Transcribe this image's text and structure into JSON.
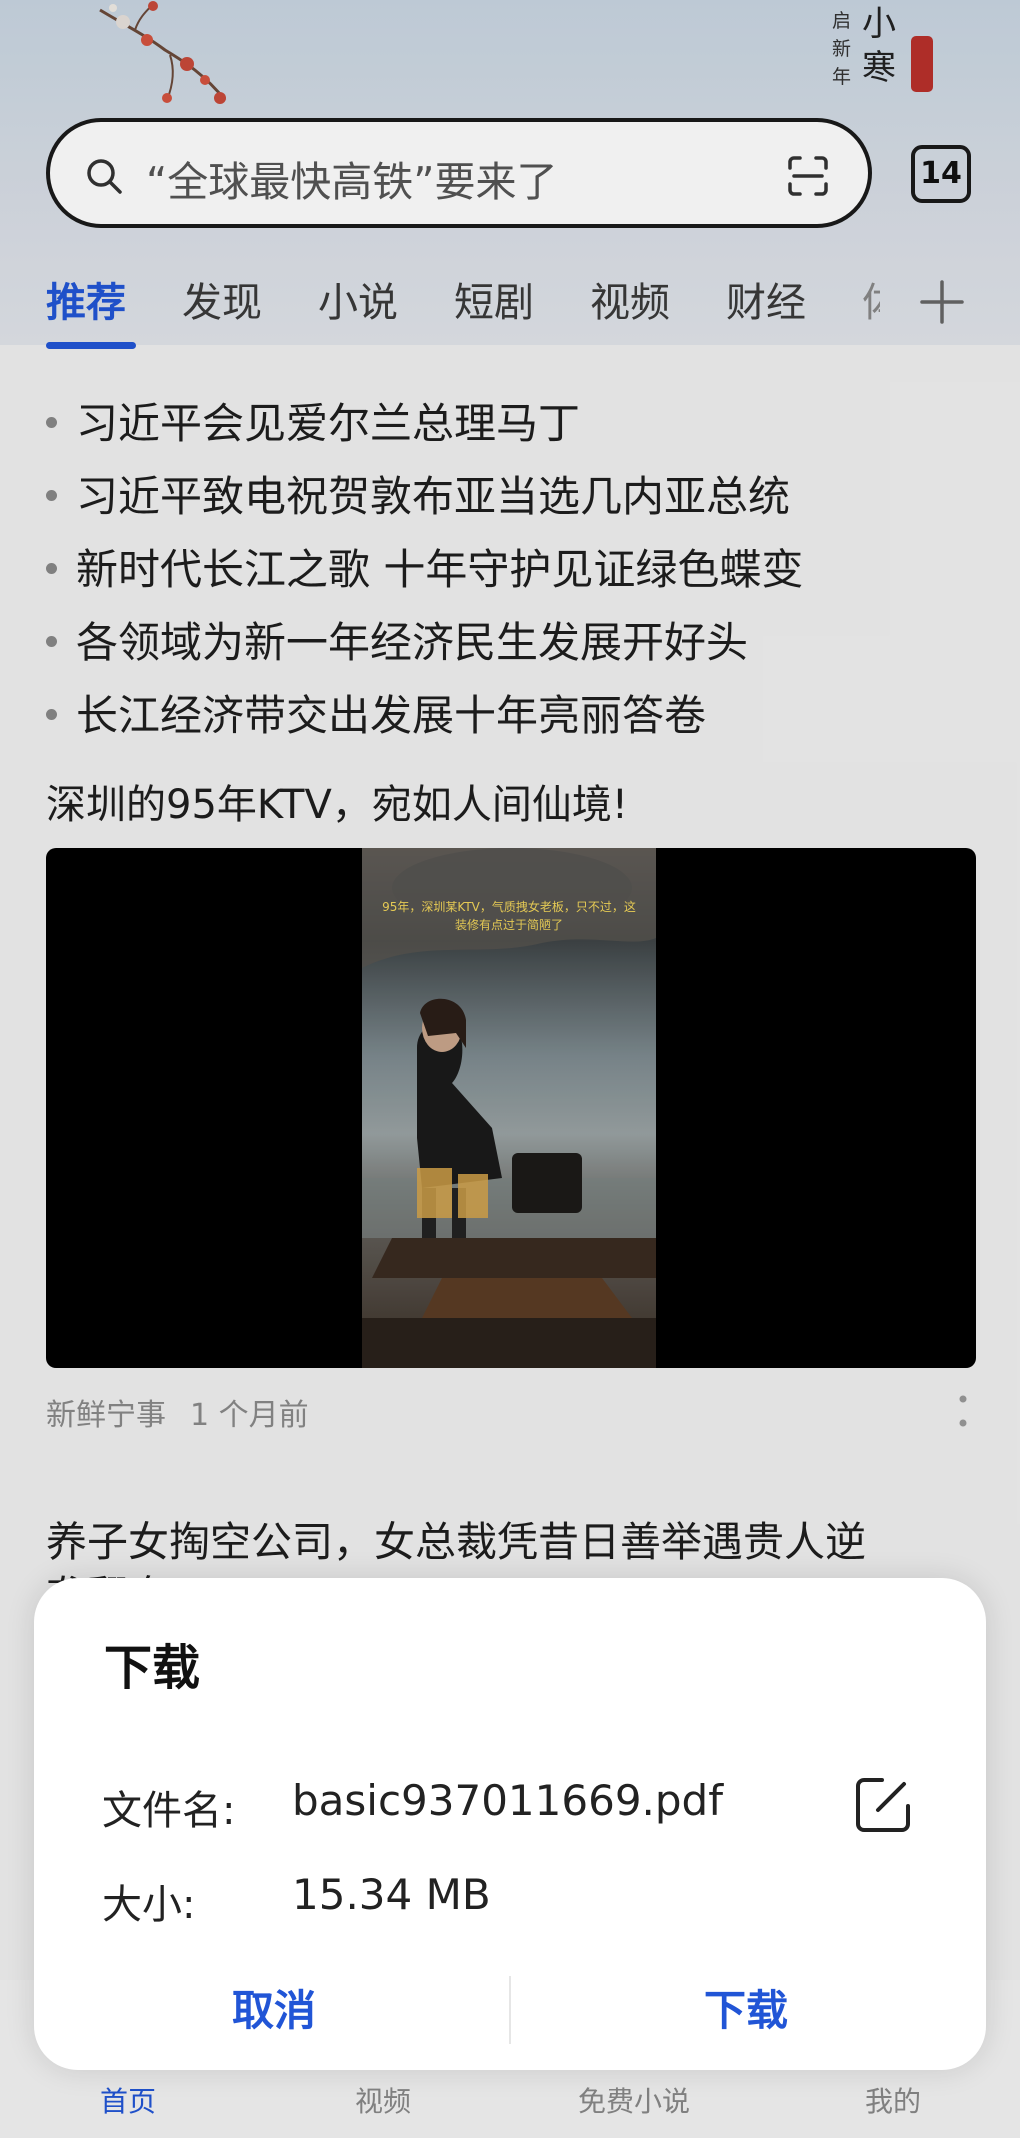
{
  "header": {
    "season": {
      "small": [
        "启",
        "新",
        "年"
      ],
      "big": [
        "小",
        "寒"
      ]
    },
    "search_placeholder": "“全球最快高铁”要来了",
    "tab_count": "14"
  },
  "tabs": [
    {
      "label": "推荐",
      "active": true
    },
    {
      "label": "发现"
    },
    {
      "label": "小说"
    },
    {
      "label": "短剧"
    },
    {
      "label": "视频"
    },
    {
      "label": "财经"
    },
    {
      "label": "体"
    }
  ],
  "hot_news": [
    "习近平会见爱尔兰总理马丁",
    "习近平致电祝贺敦布亚当选几内亚总统",
    "新时代长江之歌 十年守护见证绿色蝶变",
    "各领域为新一年经济民生发展开好头",
    "长江经济带交出发展十年亮丽答卷"
  ],
  "feed": [
    {
      "title": "深圳的95年KTV，宛如人间仙境!",
      "video_subtitle": "95年，深圳某KTV，气质拽女老板，只不过，这装修有点过于简陋了",
      "source": "新鲜宁事",
      "time": "1 个月前"
    },
    {
      "title": "养子女掏空公司，女总裁凭昔日善举遇贵人逆",
      "title_cut": "袭翻盘！"
    }
  ],
  "bottom_nav": [
    {
      "label": "首页",
      "active": true
    },
    {
      "label": "视频"
    },
    {
      "label": "免费小说"
    },
    {
      "label": "我的"
    }
  ],
  "dialog": {
    "title": "下载",
    "filename_label": "文件名:",
    "filename_value": "basic937011669.pdf",
    "size_label": "大小:",
    "size_value": "15.34 MB",
    "cancel_label": "取消",
    "download_label": "下载",
    "accent_color": "#2155d6"
  }
}
